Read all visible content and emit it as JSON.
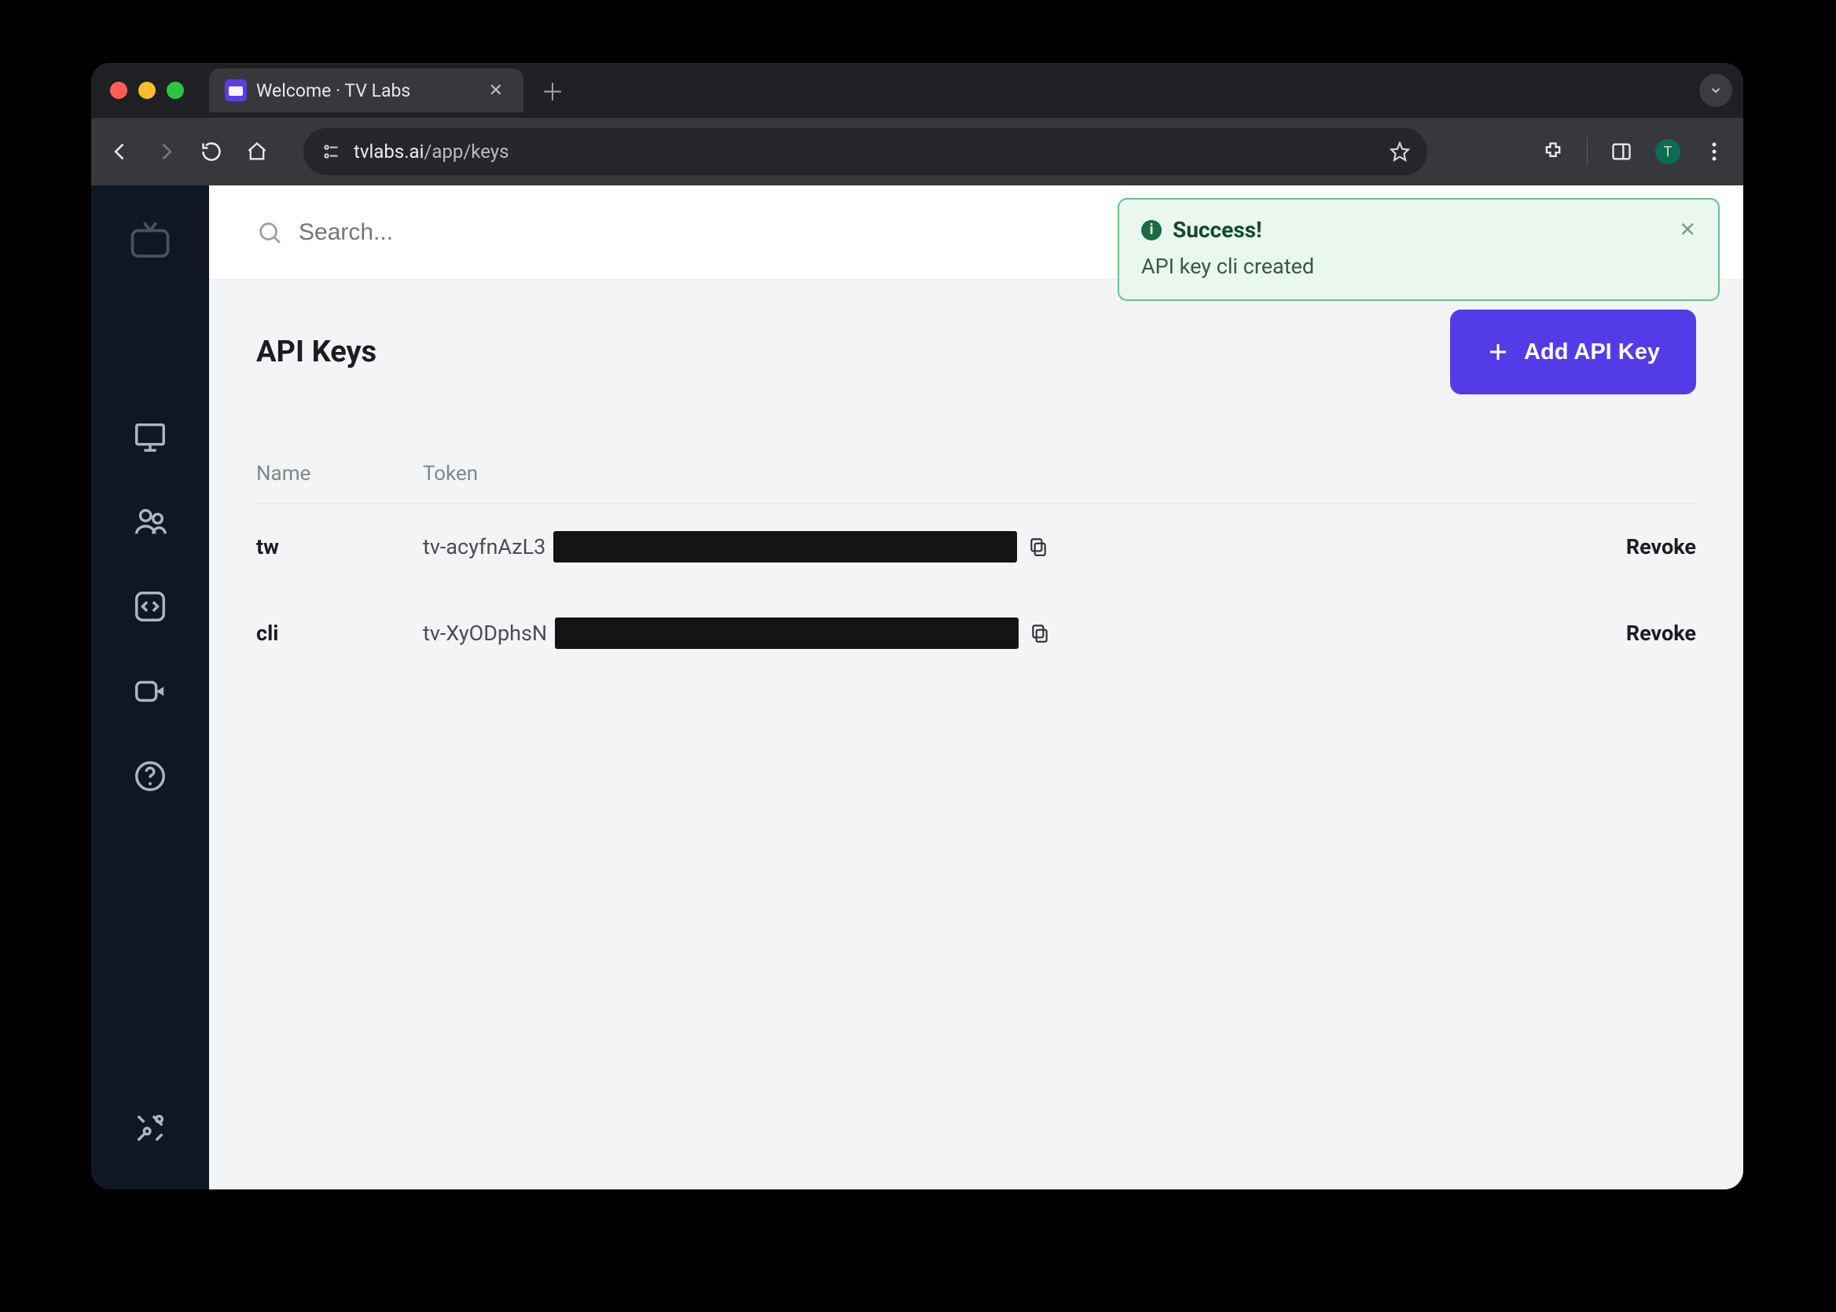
{
  "browser": {
    "tab_title": "Welcome · TV Labs",
    "url_host": "tvlabs.ai",
    "url_path": "/app/keys",
    "profile_initial": "T"
  },
  "search": {
    "placeholder": "Search..."
  },
  "page": {
    "title": "API Keys",
    "add_button": "Add API Key"
  },
  "columns": {
    "name": "Name",
    "token": "Token"
  },
  "keys": [
    {
      "name": "tw",
      "token_prefix": "tv-acyfnAzL3",
      "revoke": "Revoke"
    },
    {
      "name": "cli",
      "token_prefix": "tv-XyODphsN",
      "revoke": "Revoke"
    }
  ],
  "toast": {
    "title": "Success!",
    "message": "API key cli created"
  }
}
